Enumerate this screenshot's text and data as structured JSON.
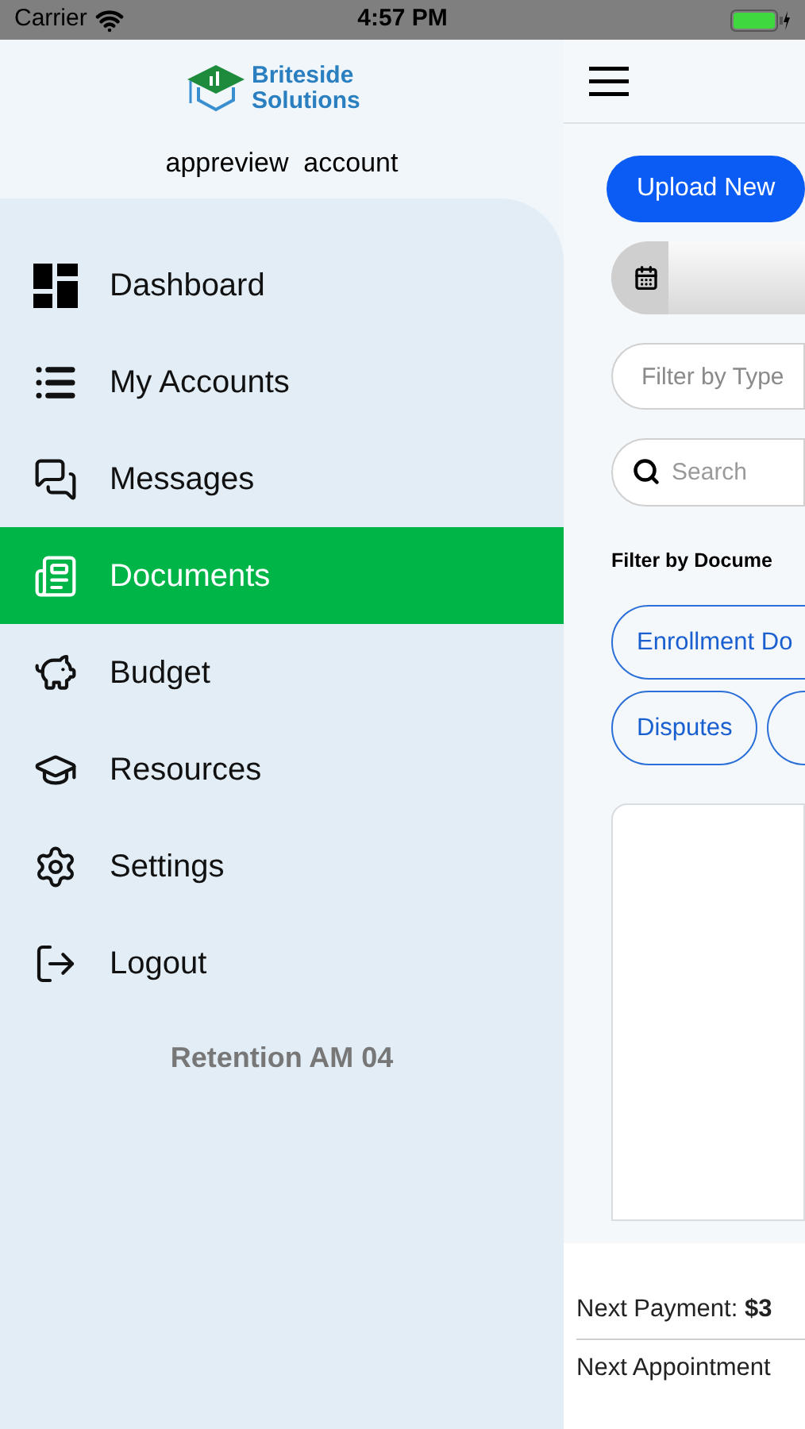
{
  "status_bar": {
    "carrier": "Carrier",
    "time": "4:57 PM"
  },
  "drawer": {
    "brand": "Briteside Solutions",
    "account": "appreview  account",
    "items": [
      {
        "label": "Dashboard",
        "kind": "dashboard",
        "selected": false
      },
      {
        "label": "My Accounts",
        "kind": "list",
        "selected": false
      },
      {
        "label": "Messages",
        "kind": "messages",
        "selected": false
      },
      {
        "label": "Documents",
        "kind": "documents",
        "selected": true
      },
      {
        "label": "Budget",
        "kind": "budget",
        "selected": false
      },
      {
        "label": "Resources",
        "kind": "resources",
        "selected": false
      },
      {
        "label": "Settings",
        "kind": "settings",
        "selected": false
      },
      {
        "label": "Logout",
        "kind": "logout",
        "selected": false
      }
    ],
    "footer": "Retention AM 04"
  },
  "main": {
    "upload_button": "Upload New",
    "type_filter": {
      "placeholder": "Filter by Type"
    },
    "search": {
      "placeholder": "Search"
    },
    "filter_label": "Filter by Docume",
    "chips": [
      [
        "Enrollment Do"
      ],
      [
        "Disputes"
      ]
    ],
    "bottom": [
      "Next Payment: **$3**",
      "Next Appointment"
    ]
  }
}
